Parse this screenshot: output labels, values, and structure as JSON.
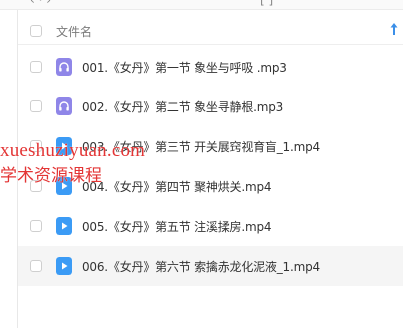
{
  "header": {
    "name_label": "文件名"
  },
  "files": [
    {
      "name": "001.《女丹》第一节 象坐与呼吸 .mp3",
      "type": "audio"
    },
    {
      "name": "002.《女丹》第二节 象坐寻静根.mp3",
      "type": "audio"
    },
    {
      "name": "003.《女丹》第三节 开关展窍视育盲_1.mp4",
      "type": "video"
    },
    {
      "name": "004.《女丹》第四节 聚神烘关.mp4",
      "type": "video"
    },
    {
      "name": "005.《女丹》第五节 注溪揉房.mp4",
      "type": "video"
    },
    {
      "name": "006.《女丹》第六节 索擒赤龙化泥液_1.mp4",
      "type": "video"
    }
  ],
  "watermark": {
    "line1": "xueshuziyuan.com",
    "line2": "学术资源课程"
  },
  "icons": {
    "audio": "headphones-icon",
    "video": "play-icon",
    "sort": "sort-up-arrow-icon"
  },
  "colors": {
    "audio_icon": "#8f86e8",
    "video_icon": "#3b9bf5",
    "sort_arrow": "#3b8fe8",
    "watermark": "#e33535"
  }
}
